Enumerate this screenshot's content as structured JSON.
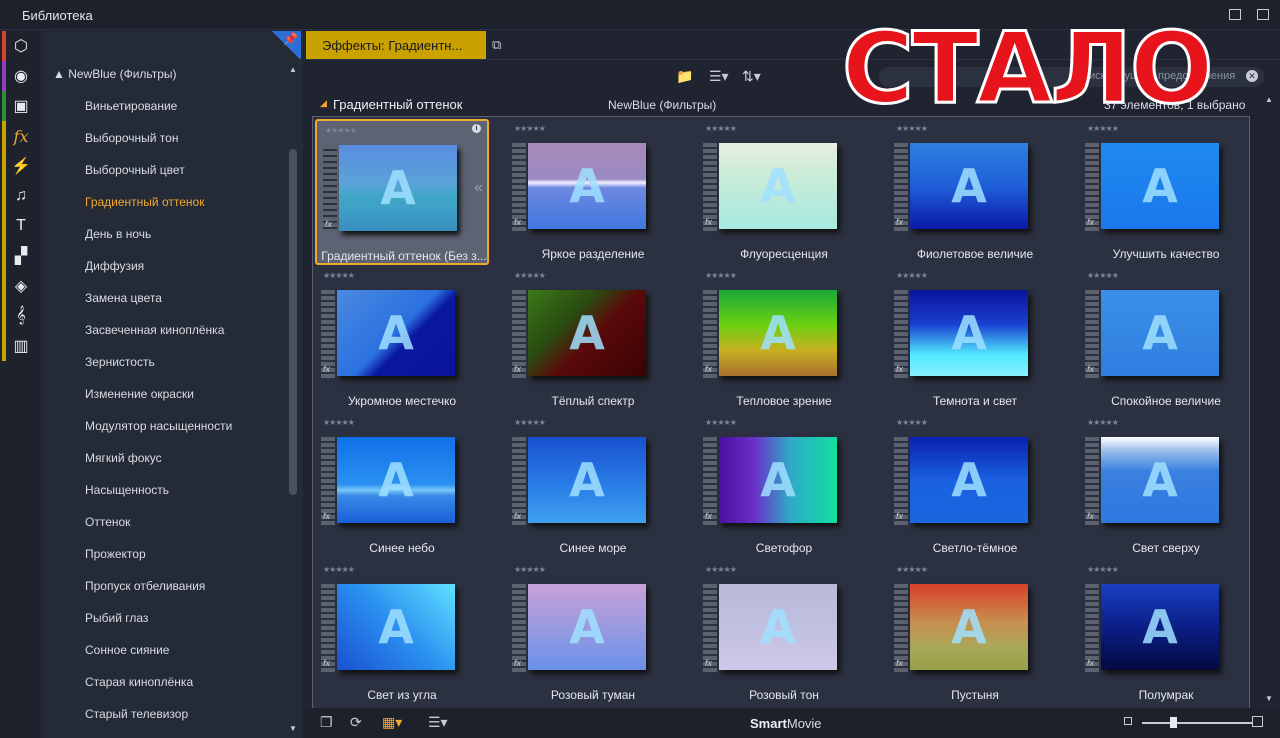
{
  "window": {
    "title": "Библиотека"
  },
  "categories": [
    {
      "icon": "box-icon",
      "glyph": "⬡",
      "color": "#d8412f"
    },
    {
      "icon": "film-reel-icon",
      "glyph": "◉",
      "color": "#8a3fc4"
    },
    {
      "icon": "photos-icon",
      "glyph": "▣",
      "color": "#2f8f3a"
    },
    {
      "icon": "fx-icon",
      "glyph": "fx",
      "color": "#c9a200"
    },
    {
      "icon": "lightning-icon",
      "glyph": "⚡",
      "color": "#c9a200"
    },
    {
      "icon": "music-note-icon",
      "glyph": "♫",
      "color": "#c9a200"
    },
    {
      "icon": "text-icon",
      "glyph": "T",
      "color": "#c9a200"
    },
    {
      "icon": "shapes-icon",
      "glyph": "▞",
      "color": "#c9a200"
    },
    {
      "icon": "layers-icon",
      "glyph": "◈",
      "color": "#c9a200"
    },
    {
      "icon": "clef-icon",
      "glyph": "𝄞",
      "color": "#c9a200"
    },
    {
      "icon": "piano-icon",
      "glyph": "▥",
      "color": "#c9a200"
    }
  ],
  "tree": {
    "root": "NewBlue (Фильтры)",
    "items": [
      "Виньетирование",
      "Выборочный тон",
      "Выборочный цвет",
      "Градиентный оттенок",
      "День в ночь",
      "Диффузия",
      "Замена цвета",
      "Засвеченная киноплёнка",
      "Зернистость",
      "Изменение окраски",
      "Модулятор насыщенности",
      "Мягкий фокус",
      "Насыщенность",
      "Оттенок",
      "Прожектор",
      "Пропуск отбеливания",
      "Рыбий глаз",
      "Сонное сияние",
      "Старая киноплёнка",
      "Старый телевизор"
    ],
    "selected_index": 3
  },
  "tab": {
    "label": "Эффекты: Градиентн..."
  },
  "search": {
    "placeholder": "Поиск текущего представления"
  },
  "header": {
    "title": "Градиентный оттенок",
    "plugin": "NewBlue (Фильтры)",
    "count": "37 элементов, 1 выбрано"
  },
  "effects": [
    {
      "name": "Градиентный оттенок (Без з...",
      "bg": "linear-gradient(180deg,#5b8de0 0%,#5aa2d8 45%,#3fa8c8 60%,#3a8fc0 100%)"
    },
    {
      "name": "Яркое разделение",
      "bg": "linear-gradient(180deg,#a889b8 0%,#9b8ac4 42%,#f4f6ff 46%,#6e88e0 52%,#3f78e0 100%)"
    },
    {
      "name": "Флуоресценция",
      "bg": "linear-gradient(180deg,#e8eee0 0%,#c8ecd8 40%,#a8e8e0 100%)"
    },
    {
      "name": "Фиолетовое величие",
      "bg": "linear-gradient(180deg,#2d7fe0 0%,#1f5fd8 50%,#0a1aa8 100%)"
    },
    {
      "name": "Улучшить качество",
      "bg": "linear-gradient(180deg,#1f8af0 0%,#1a78ec 100%)"
    },
    {
      "name": "Укромное местечко",
      "bg": "linear-gradient(135deg,#4a8ae0 0%,#2b70e0 50%,#0a18a0 60%,#0a149a 100%)"
    },
    {
      "name": "Тёплый спектр",
      "bg": "linear-gradient(135deg,#3a7a1a 0%,#2a4a10 35%,#5a0a0a 55%,#3a0202 100%)"
    },
    {
      "name": "Тепловое зрение",
      "bg": "linear-gradient(180deg,#1aa83a 0%,#6ad010 40%,#c8b020 70%,#a87030 100%)"
    },
    {
      "name": "Темнота и свет",
      "bg": "linear-gradient(180deg,#0a149a 0%,#1a40d0 40%,#50e8ff 75%,#8af0ff 100%)"
    },
    {
      "name": "Спокойное величие",
      "bg": "linear-gradient(180deg,#3a90e8 0%,#2f7de0 100%)"
    },
    {
      "name": "Синее небо",
      "bg": "linear-gradient(180deg,#1070e8 0%,#2a90f0 55%,#7ac8f8 62%,#3a8ae8 68%,#1a60d8 100%)"
    },
    {
      "name": "Синее море",
      "bg": "linear-gradient(180deg,#1a50d0 0%,#2a80e8 60%,#40a0f0 100%)"
    },
    {
      "name": "Светофор",
      "bg": "linear-gradient(90deg,#4a10a0 0%,#6a30c8 30%,#30a8c8 60%,#10e0a0 100%)"
    },
    {
      "name": "Светло-тёмное",
      "bg": "linear-gradient(180deg,#0a20b0 0%,#1a60e0 50%,#1a68e0 100%)"
    },
    {
      "name": "Свет сверху",
      "bg": "linear-gradient(180deg,#ffffff 0%,#90b8e8 18%,#3a80e0 40%,#2f78e0 100%)"
    },
    {
      "name": "Свет из угла",
      "bg": "linear-gradient(45deg,#1a50d0 0%,#2a90f0 50%,#60e0ff 100%)"
    },
    {
      "name": "Розовый туман",
      "bg": "linear-gradient(180deg,#c8a0d8 0%,#9a9ae0 50%,#6a90e8 100%)"
    },
    {
      "name": "Розовый тон",
      "bg": "linear-gradient(180deg,#b8b8d8 0%,#c0c0e0 50%,#d0c8e8 100%)"
    },
    {
      "name": "Пустыня",
      "bg": "linear-gradient(180deg,#d8402a 0%,#c89050 45%,#a8a858 75%,#98a048 100%)"
    },
    {
      "name": "Полумрак",
      "bg": "linear-gradient(180deg,#1a40c0 0%,#0a1e88 50%,#050a40 100%)"
    }
  ],
  "footer": {
    "brand_bold": "Smart",
    "brand_rest": "Movie"
  },
  "overlay": {
    "text": "СТАЛО"
  },
  "colors": {
    "accent": "#f2a72e",
    "tab": "#c9a200",
    "overlay_red": "#e8141c"
  }
}
